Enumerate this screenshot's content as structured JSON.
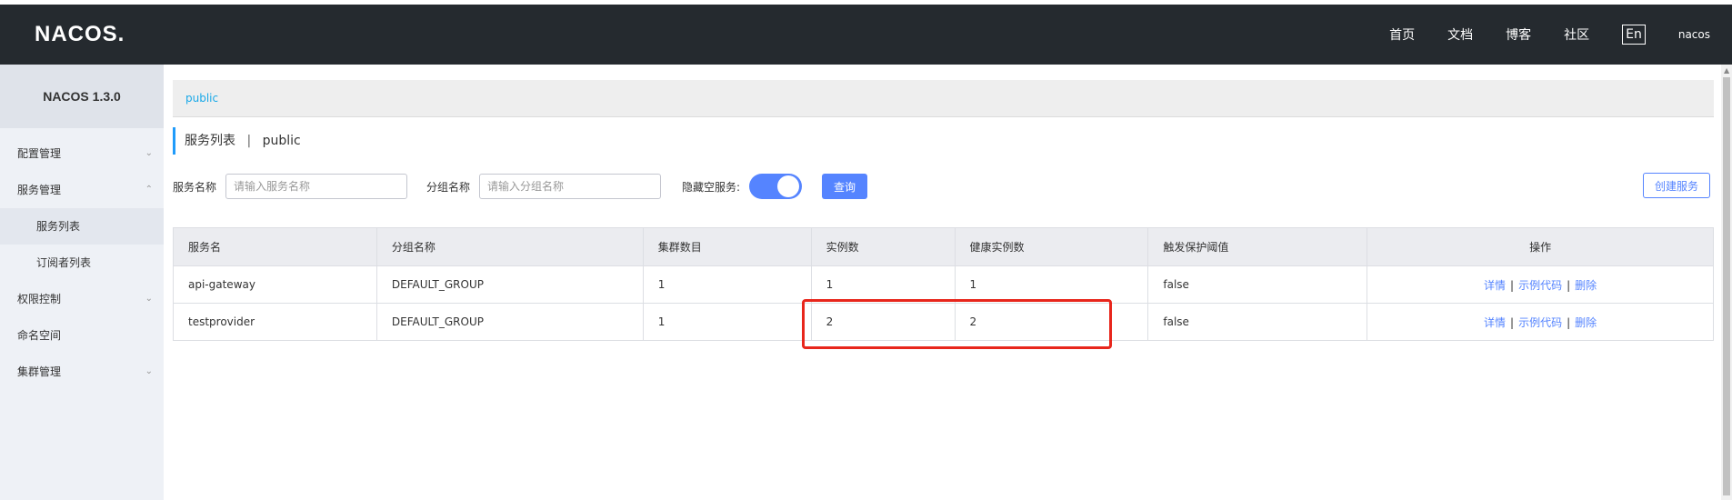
{
  "header": {
    "logo": "NACOS.",
    "nav": [
      "首页",
      "文档",
      "博客",
      "社区"
    ],
    "lang": "En",
    "user": "nacos"
  },
  "sidebar": {
    "brand": "NACOS 1.3.0",
    "items": [
      {
        "label": "配置管理",
        "chevron": "down"
      },
      {
        "label": "服务管理",
        "chevron": "up"
      },
      {
        "label": "服务列表",
        "sub": true,
        "active": true
      },
      {
        "label": "订阅者列表",
        "sub": true
      },
      {
        "label": "权限控制",
        "chevron": "down"
      },
      {
        "label": "命名空间"
      },
      {
        "label": "集群管理",
        "chevron": "down"
      }
    ]
  },
  "breadcrumb": {
    "namespace": "public"
  },
  "page": {
    "title": "服务列表",
    "separator": "|",
    "namespace": "public"
  },
  "filters": {
    "service_label": "服务名称",
    "service_placeholder": "请输入服务名称",
    "group_label": "分组名称",
    "group_placeholder": "请输入分组名称",
    "hide_empty_label": "隐藏空服务:",
    "hide_empty_on": true,
    "query_button": "查询",
    "create_button": "创建服务"
  },
  "table": {
    "headers": [
      "服务名",
      "分组名称",
      "集群数目",
      "实例数",
      "健康实例数",
      "触发保护阈值",
      "操作"
    ],
    "rows": [
      {
        "name": "api-gateway",
        "group": "DEFAULT_GROUP",
        "clusters": "1",
        "instances": "1",
        "healthy": "1",
        "threshold": "false"
      },
      {
        "name": "testprovider",
        "group": "DEFAULT_GROUP",
        "clusters": "1",
        "instances": "2",
        "healthy": "2",
        "threshold": "false"
      }
    ],
    "ops": {
      "detail": "详情",
      "sample": "示例代码",
      "delete": "删除",
      "sep": "|"
    }
  },
  "colors": {
    "header_bg": "#252a2f",
    "primary": "#5584ff",
    "highlight": "#e8261c"
  }
}
